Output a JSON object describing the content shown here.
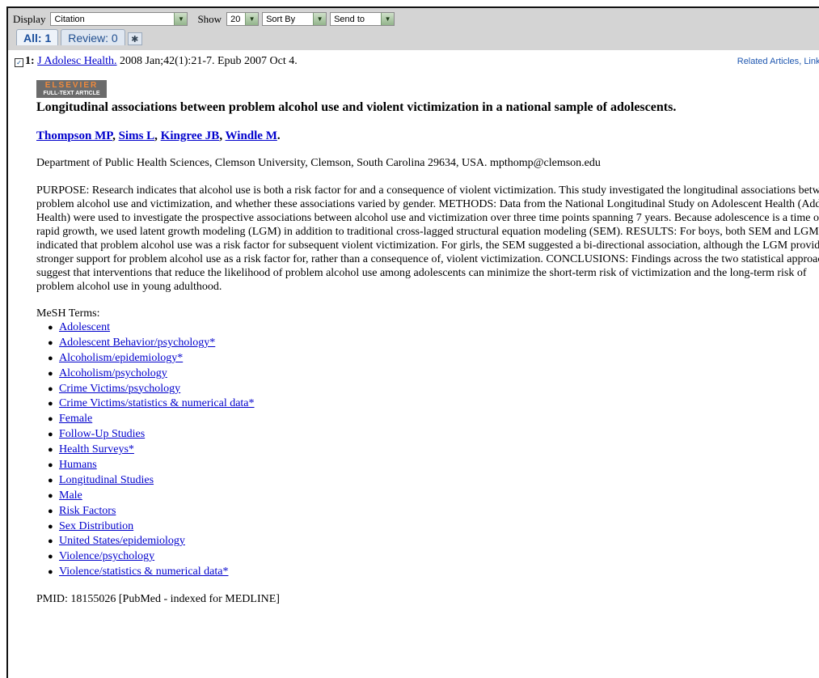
{
  "toolbar": {
    "display_label": "Display",
    "display_value": "Citation",
    "show_label": "Show",
    "show_value": "20",
    "sortby_value": "Sort By",
    "sendto_value": "Send to"
  },
  "tabs": [
    {
      "label": "All: 1"
    },
    {
      "label": "Review: 0"
    }
  ],
  "citation": {
    "number": "1:",
    "journal": "J Adolesc Health.",
    "details": " 2008 Jan;42(1):21-7. Epub 2007 Oct 4.",
    "related": "Related Articles",
    "links": "Links",
    "publisher_badge_top": "ELSEVIER",
    "publisher_badge_bottom": "FULL-TEXT ARTICLE",
    "title": "Longitudinal associations between problem alcohol use and violent victimization in a national sample of adolescents.",
    "authors": [
      "Thompson MP",
      "Sims L",
      "Kingree JB",
      "Windle M"
    ],
    "affiliation": "Department of Public Health Sciences, Clemson University, Clemson, South Carolina 29634, USA. mpthomp@clemson.edu",
    "abstract": "PURPOSE: Research indicates that alcohol use is both a risk factor for and a consequence of violent victimization. This study investigated the longitudinal associations between problem alcohol use and victimization, and whether these associations varied by gender. METHODS: Data from the National Longitudinal Study on Adolescent Health (Add Health) were used to investigate the prospective associations between alcohol use and victimization over three time points spanning 7 years. Because adolescence is a time of rapid growth, we used latent growth modeling (LGM) in addition to traditional cross-lagged structural equation modeling (SEM). RESULTS: For boys, both SEM and LGM indicated that problem alcohol use was a risk factor for subsequent violent victimization. For girls, the SEM suggested a bi-directional association, although the LGM provided stronger support for problem alcohol use as a risk factor for, rather than a consequence of, violent victimization. CONCLUSIONS: Findings across the two statistical approaches suggest that interventions that reduce the likelihood of problem alcohol use among adolescents can minimize the short-term risk of victimization and the long-term risk of problem alcohol use in young adulthood.",
    "mesh_heading": "MeSH Terms:",
    "mesh_terms": [
      "Adolescent",
      "Adolescent Behavior/psychology*",
      "Alcoholism/epidemiology*",
      "Alcoholism/psychology",
      "Crime Victims/psychology",
      "Crime Victims/statistics & numerical data*",
      "Female",
      "Follow-Up Studies",
      "Health Surveys*",
      "Humans",
      "Longitudinal Studies",
      "Male",
      "Risk Factors",
      "Sex Distribution",
      "United States/epidemiology",
      "Violence/psychology",
      "Violence/statistics & numerical data*"
    ],
    "pmid": "PMID: 18155026 [PubMed - indexed for MEDLINE]"
  }
}
